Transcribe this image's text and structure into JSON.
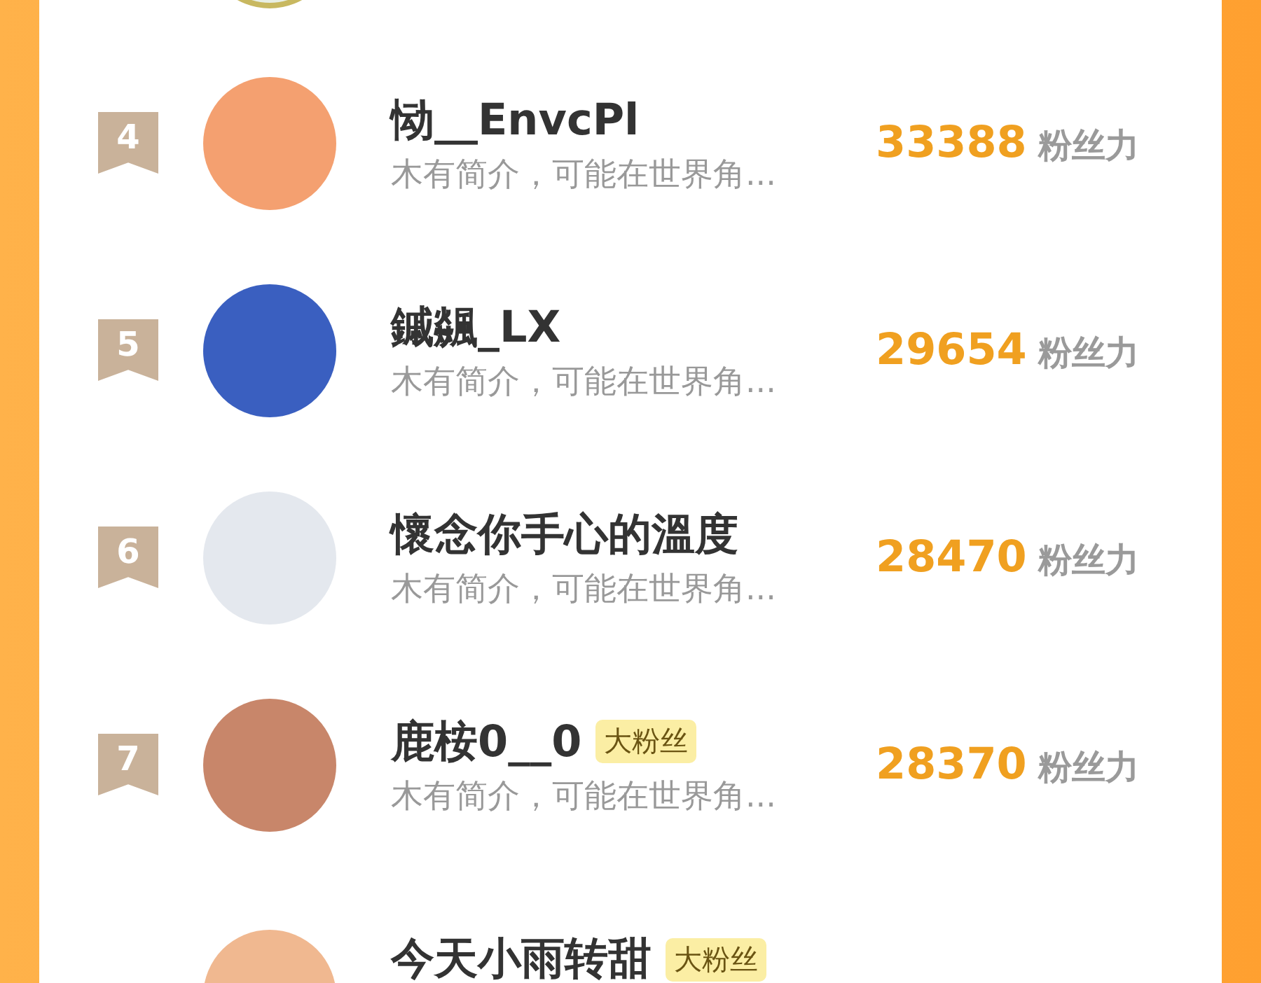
{
  "ranking": [
    {
      "rank": "4",
      "name": "恸__EnvcPl",
      "bio": "木有简介，可能在世界角...",
      "score": "33388",
      "score_unit": "粉丝力"
    },
    {
      "rank": "5",
      "name": "鏚飊_LX",
      "bio": "木有简介，可能在世界角...",
      "score": "29654",
      "score_unit": "粉丝力"
    },
    {
      "rank": "6",
      "name": "懷念你手心的溫度",
      "bio": "木有简介，可能在世界角...",
      "score": "28470",
      "score_unit": "粉丝力"
    },
    {
      "rank": "7",
      "name": "鹿桉0__0",
      "badge": "大粉丝",
      "bio": "木有简介，可能在世界角...",
      "score": "28370",
      "score_unit": "粉丝力"
    },
    {
      "name": "今天小雨转甜",
      "badge": "大粉丝"
    }
  ]
}
